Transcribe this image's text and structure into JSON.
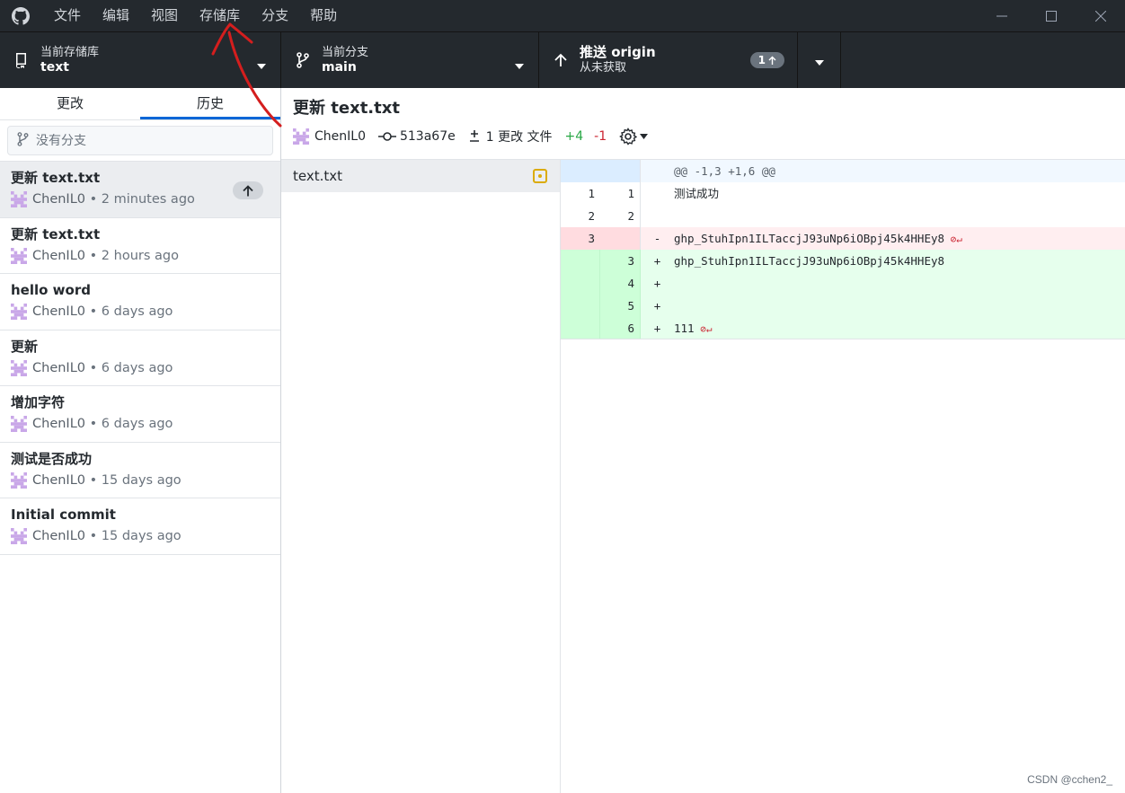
{
  "titlebar": {
    "menu": [
      "文件",
      "编辑",
      "视图",
      "存储库",
      "分支",
      "帮助"
    ]
  },
  "toolbar": {
    "repo": {
      "label": "当前存储库",
      "value": "text"
    },
    "branch": {
      "label": "当前分支",
      "value": "main"
    },
    "push": {
      "label": "推送 origin",
      "sub": "从未获取",
      "badge_count": "1"
    }
  },
  "sidebar": {
    "tabs": [
      {
        "label": "更改",
        "active": false
      },
      {
        "label": "历史",
        "active": true
      }
    ],
    "filter_placeholder": "没有分支",
    "commits": [
      {
        "title": "更新 text.txt",
        "author": "ChenIL0",
        "time": "2 minutes ago",
        "selected": true,
        "unpushed": true
      },
      {
        "title": "更新 text.txt",
        "author": "ChenIL0",
        "time": "2 hours ago"
      },
      {
        "title": "hello word",
        "author": "ChenIL0",
        "time": "6 days ago"
      },
      {
        "title": "更新",
        "author": "ChenIL0",
        "time": "6 days ago"
      },
      {
        "title": "增加字符",
        "author": "ChenIL0",
        "time": "6 days ago"
      },
      {
        "title": "测试是否成功",
        "author": "ChenIL0",
        "time": "15 days ago"
      },
      {
        "title": "Initial commit",
        "author": "ChenIL0",
        "time": "15 days ago"
      }
    ]
  },
  "commit": {
    "title": "更新 text.txt",
    "author": "ChenIL0",
    "sha": "513a67e",
    "files_changed": "1 更改 文件",
    "additions": "+4",
    "deletions": "-1"
  },
  "files": [
    {
      "name": "text.txt",
      "status": "modified"
    }
  ],
  "diff": [
    {
      "type": "hunk",
      "old": "",
      "new": "",
      "sign": "",
      "text": "@@ -1,3 +1,6 @@"
    },
    {
      "type": "ctx",
      "old": "1",
      "new": "1",
      "sign": "",
      "text": "测试成功"
    },
    {
      "type": "ctx",
      "old": "2",
      "new": "2",
      "sign": "",
      "text": ""
    },
    {
      "type": "del",
      "old": "3",
      "new": "",
      "sign": "-",
      "text": "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",
      "no_newline": true
    },
    {
      "type": "add",
      "old": "",
      "new": "3",
      "sign": "+",
      "text": "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"
    },
    {
      "type": "add",
      "old": "",
      "new": "4",
      "sign": "+",
      "text": ""
    },
    {
      "type": "add",
      "old": "",
      "new": "5",
      "sign": "+",
      "text": ""
    },
    {
      "type": "add",
      "old": "",
      "new": "6",
      "sign": "+",
      "text": "111",
      "no_newline": true
    }
  ],
  "watermark": "CSDN @cchen2_",
  "colors": {
    "annotation": "#d41e1e",
    "accent": "#0366d6",
    "addition": "#28a745",
    "deletion": "#cb2431"
  }
}
